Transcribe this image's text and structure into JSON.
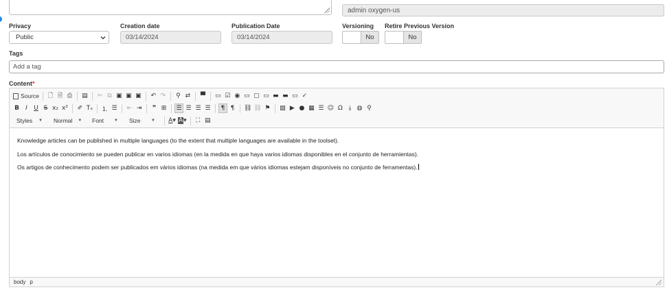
{
  "author": {
    "value": "admin oxygen-us"
  },
  "privacy": {
    "label": "Privacy",
    "value": "Public"
  },
  "creation_date": {
    "label": "Creation date",
    "value": "03/14/2024"
  },
  "publication_date": {
    "label": "Publication Date",
    "value": "03/14/2024"
  },
  "versioning": {
    "label": "Versioning",
    "value": "No"
  },
  "retire_previous": {
    "label": "Retire Previous Version",
    "value": "No"
  },
  "tags": {
    "label": "Tags",
    "placeholder": "Add a tag"
  },
  "content": {
    "label": "Content",
    "required_mark": "*",
    "paragraphs": [
      "Knowledge articles can be published in multiple languages (to the extent that multiple languages are available in the toolset).",
      "Los artículos de conocimiento se pueden publicar en varios idiomas (en la medida en que haya varios idiomas disponibles en el conjunto de herramientas).",
      "Os artigos de conhecimento podem ser publicados em vários idiomas (na medida em que vários idiomas estejam disponíveis no conjunto de ferramentas)."
    ]
  },
  "toolbar": {
    "source_label": "Source",
    "styles_label": "Styles",
    "format_label": "Normal",
    "font_label": "Font",
    "size_label": "Size"
  },
  "statusbar": {
    "path": [
      "body",
      "p"
    ]
  },
  "colors": {
    "accent": "#1e88e5",
    "required": "#d32f2f",
    "readonly_bg": "#ececec"
  }
}
